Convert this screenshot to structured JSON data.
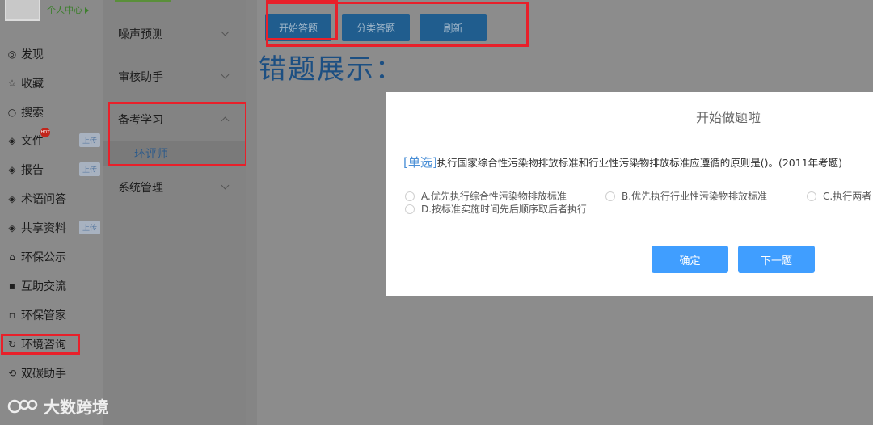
{
  "user": {
    "link": "个人中心"
  },
  "nav": [
    {
      "label": "发现",
      "icon": "eye-icon",
      "glyph": "◎"
    },
    {
      "label": "收藏",
      "icon": "star-icon",
      "glyph": "☆"
    },
    {
      "label": "搜索",
      "icon": "search-icon",
      "glyph": "○"
    },
    {
      "label": "文件",
      "icon": "layers-icon",
      "glyph": "◈",
      "badge": "上传",
      "hot": "HOT"
    },
    {
      "label": "报告",
      "icon": "layers-icon",
      "glyph": "◈",
      "badge": "上传"
    },
    {
      "label": "术语问答",
      "icon": "layers-icon",
      "glyph": "◈"
    },
    {
      "label": "共享资料",
      "icon": "layers-icon",
      "glyph": "◈",
      "badge": "上传"
    },
    {
      "label": "环保公示",
      "icon": "building-icon",
      "glyph": "⌂"
    },
    {
      "label": "互助交流",
      "icon": "chat-icon",
      "glyph": "▪"
    },
    {
      "label": "环保管家",
      "icon": "message-icon",
      "glyph": "▫"
    },
    {
      "label": "环境咨询",
      "icon": "refresh-icon",
      "glyph": "↻"
    },
    {
      "label": "双碳助手",
      "icon": "sync-icon",
      "glyph": "⟲"
    }
  ],
  "submenu": {
    "items": [
      {
        "label": "噪声预测"
      },
      {
        "label": "审核助手"
      },
      {
        "label": "备考学习"
      },
      {
        "label": "系统管理"
      }
    ],
    "active_child": "环评师"
  },
  "toolbar": {
    "start": "开始答题",
    "category": "分类答题",
    "refresh": "刷新"
  },
  "main": {
    "title": "错题展示："
  },
  "modal": {
    "title": "开始做题啦",
    "question_type": "[单选]",
    "question_text": "执行国家综合性污染物排放标准和行业性污染物排放标准应遵循的原则是()。(2011年考题)",
    "options": {
      "a": "A.优先执行综合性污染物排放标准",
      "b": "B.优先执行行业性污染物排放标准",
      "c": "C.执行两者",
      "d": "D.按标准实施时间先后顺序取后者执行"
    },
    "confirm": "确定",
    "next": "下一题"
  },
  "watermark": "大数跨境",
  "colors": {
    "primary": "#409eff",
    "highlight": "#e8202a"
  }
}
